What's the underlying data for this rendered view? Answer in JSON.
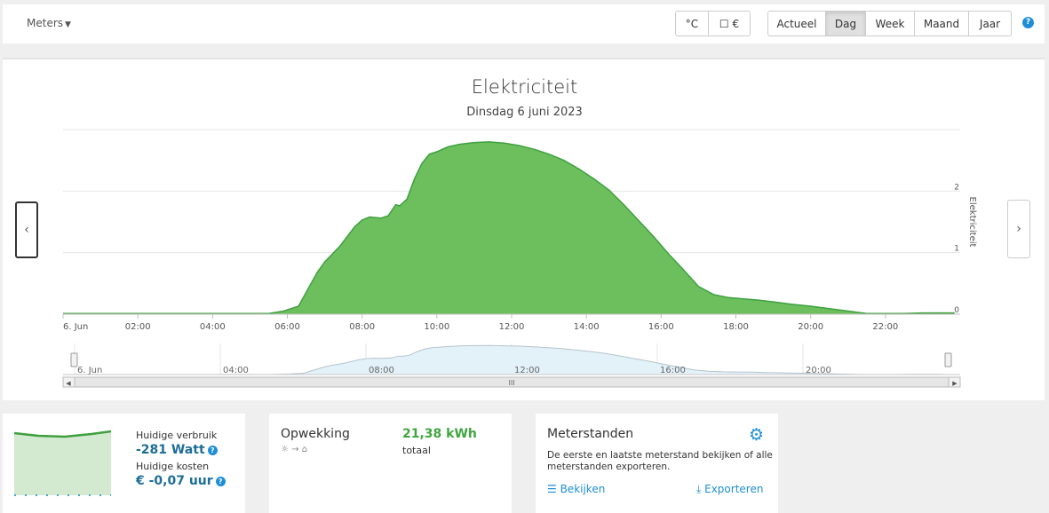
{
  "topbar": {
    "meters_label": "Meters",
    "unit_buttons": [
      "°C",
      "☐ €"
    ],
    "period_buttons": [
      "Actueel",
      "Dag",
      "Week",
      "Maand",
      "Jaar"
    ],
    "active_period": "Dag",
    "help": "?"
  },
  "chart_data": {
    "type": "area",
    "title": "Elektriciteit",
    "subtitle": "Dinsdag 6 juni 2023",
    "ylabel": "Elektriciteit",
    "xlabel": "",
    "xlim": [
      0,
      24
    ],
    "ylim": [
      0,
      3
    ],
    "y_ticks": [
      0,
      1,
      2
    ],
    "x_ticks": [
      {
        "h": 0,
        "label": "6. Jun"
      },
      {
        "h": 2,
        "label": "02:00"
      },
      {
        "h": 4,
        "label": "04:00"
      },
      {
        "h": 6,
        "label": "06:00"
      },
      {
        "h": 8,
        "label": "08:00"
      },
      {
        "h": 10,
        "label": "10:00"
      },
      {
        "h": 12,
        "label": "12:00"
      },
      {
        "h": 14,
        "label": "14:00"
      },
      {
        "h": 16,
        "label": "16:00"
      },
      {
        "h": 18,
        "label": "18:00"
      },
      {
        "h": 20,
        "label": "20:00"
      },
      {
        "h": 22,
        "label": "22:00"
      }
    ],
    "grid": true,
    "series": [
      {
        "color": "#6dbf5e",
        "line_color": "#3fa03f",
        "x": [
          0,
          5.5,
          5.9,
          6.3,
          6.5,
          6.8,
          7.0,
          7.4,
          7.8,
          8.0,
          8.2,
          8.5,
          8.7,
          8.9,
          9.0,
          9.2,
          9.4,
          9.6,
          9.8,
          10.0,
          10.3,
          10.6,
          11.0,
          11.4,
          11.8,
          12.2,
          12.6,
          13.0,
          13.4,
          13.8,
          14.2,
          14.6,
          15.0,
          15.4,
          15.8,
          16.2,
          16.6,
          17.0,
          17.4,
          17.8,
          18.2,
          18.6,
          19.0,
          19.5,
          20.0,
          20.5,
          21.0,
          21.5,
          22.0,
          22.5,
          23.0,
          23.85
        ],
        "y": [
          0.01,
          0.01,
          0.05,
          0.13,
          0.35,
          0.68,
          0.85,
          1.1,
          1.42,
          1.53,
          1.58,
          1.56,
          1.6,
          1.78,
          1.76,
          1.87,
          2.2,
          2.45,
          2.6,
          2.64,
          2.72,
          2.76,
          2.79,
          2.8,
          2.78,
          2.74,
          2.68,
          2.6,
          2.5,
          2.36,
          2.2,
          2.02,
          1.78,
          1.52,
          1.26,
          0.98,
          0.72,
          0.45,
          0.32,
          0.27,
          0.25,
          0.23,
          0.2,
          0.16,
          0.13,
          0.09,
          0.05,
          0.01,
          0.01,
          0.01,
          0.02,
          0.02
        ]
      }
    ],
    "navigator": {
      "x_ticks": [
        {
          "h": 0,
          "label": "6. Jun"
        },
        {
          "h": 4,
          "label": "04:00"
        },
        {
          "h": 8,
          "label": "08:00"
        },
        {
          "h": 12,
          "label": "12:00"
        },
        {
          "h": 16,
          "label": "16:00"
        },
        {
          "h": 20,
          "label": "20:00"
        }
      ],
      "scroll_grip": "III"
    }
  },
  "cards": {
    "usage": {
      "verbruik_label": "Huidige verbruik",
      "verbruik_value": "-281 Watt",
      "kosten_label": "Huidige kosten",
      "kosten_value": "€ -0,07 uur"
    },
    "generation": {
      "title": "Opwekking",
      "value": "21,38 kWh",
      "value_label": "totaal",
      "icons": "☼ → ⌂"
    },
    "meters": {
      "title": "Meterstanden",
      "description": "De eerste en laatste meterstand bekijken of alle meterstanden exporteren.",
      "view_label": "Bekijken",
      "export_label": "Exporteren"
    }
  }
}
